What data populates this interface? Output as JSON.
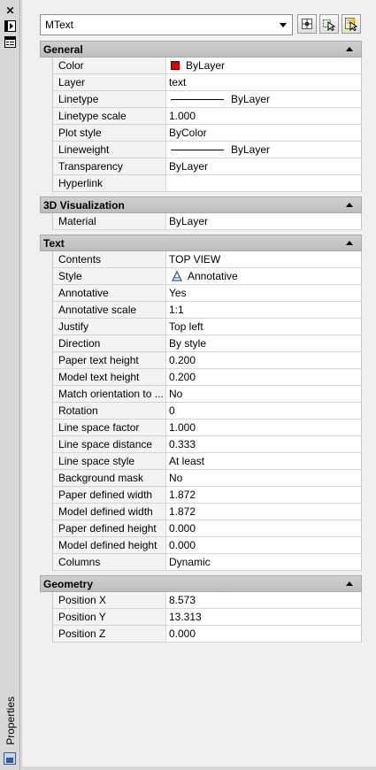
{
  "palette": {
    "title": "Properties"
  },
  "object_select": {
    "value": "MText"
  },
  "icons": {
    "close": "close-icon",
    "auto_hide": "auto-hide-icon",
    "palette_menu": "palette-menu-icon",
    "toggle_pickadd": "pickadd-icon",
    "select_objects": "select-objects-icon",
    "quick_select": "quick-select-icon"
  },
  "colors": {
    "bylayer_swatch": "#e00000",
    "section_header": "#c6c6c6"
  },
  "general": {
    "title": "General",
    "rows": [
      {
        "name": "Color",
        "value": "ByLayer"
      },
      {
        "name": "Layer",
        "value": "text"
      },
      {
        "name": "Linetype",
        "value": "ByLayer"
      },
      {
        "name": "Linetype scale",
        "value": "1.000"
      },
      {
        "name": "Plot style",
        "value": "ByColor"
      },
      {
        "name": "Lineweight",
        "value": "ByLayer"
      },
      {
        "name": "Transparency",
        "value": "ByLayer"
      },
      {
        "name": "Hyperlink",
        "value": ""
      }
    ]
  },
  "visualization": {
    "title": "3D Visualization",
    "rows": [
      {
        "name": "Material",
        "value": "ByLayer"
      }
    ]
  },
  "text": {
    "title": "Text",
    "rows": [
      {
        "name": "Contents",
        "value": "TOP VIEW"
      },
      {
        "name": "Style",
        "value": "Annotative"
      },
      {
        "name": "Annotative",
        "value": "Yes"
      },
      {
        "name": "Annotative scale",
        "value": "1:1"
      },
      {
        "name": "Justify",
        "value": "Top left"
      },
      {
        "name": "Direction",
        "value": "By style"
      },
      {
        "name": "Paper text height",
        "value": "0.200"
      },
      {
        "name": "Model text height",
        "value": "0.200"
      },
      {
        "name": "Match orientation to ...",
        "value": "No"
      },
      {
        "name": "Rotation",
        "value": "0"
      },
      {
        "name": "Line space factor",
        "value": "1.000"
      },
      {
        "name": "Line space distance",
        "value": "0.333"
      },
      {
        "name": "Line space style",
        "value": "At least"
      },
      {
        "name": "Background mask",
        "value": "No"
      },
      {
        "name": "Paper defined width",
        "value": "1.872"
      },
      {
        "name": "Model defined width",
        "value": "1.872"
      },
      {
        "name": "Paper defined height",
        "value": "0.000"
      },
      {
        "name": "Model defined height",
        "value": "0.000"
      },
      {
        "name": "Columns",
        "value": "Dynamic"
      }
    ]
  },
  "geometry": {
    "title": "Geometry",
    "rows": [
      {
        "name": "Position X",
        "value": "8.573"
      },
      {
        "name": "Position Y",
        "value": "13.313"
      },
      {
        "name": "Position Z",
        "value": "0.000"
      }
    ]
  }
}
